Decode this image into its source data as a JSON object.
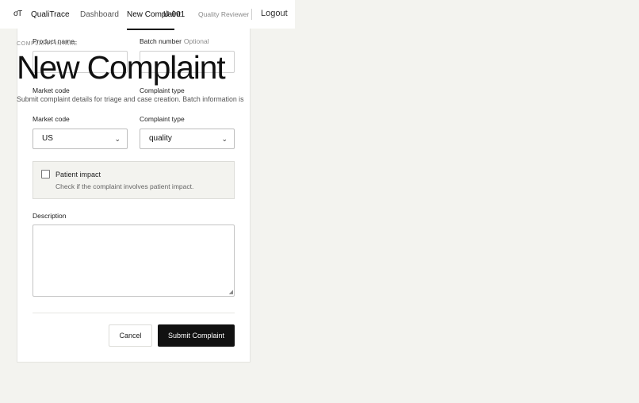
{
  "header": {
    "logo_text": "σT",
    "brand": "QualiTrace",
    "nav": {
      "dashboard": "Dashboard",
      "active": "New Complaint"
    },
    "user_id": "U-001",
    "role": "Quality Reviewer",
    "logout": "Logout"
  },
  "page": {
    "eyebrow": "COMPLAINT INTAKE",
    "title": "New Complaint",
    "subtitle": "Submit complaint details for triage and case creation. Batch information is"
  },
  "form": {
    "product_label": "Product name",
    "batch_label": "Batch number",
    "batch_optional": "Optional",
    "market_label": "Market code",
    "type_label": "Complaint type",
    "market_value": "US",
    "type_value": "quality",
    "impact_title": "Patient impact",
    "impact_help": "Check if the complaint involves patient impact.",
    "description_label": "Description",
    "cancel": "Cancel",
    "submit": "Submit Complaint"
  },
  "icons": {
    "chevron": "chevron-down-icon",
    "resize": "resize-handle-icon"
  }
}
